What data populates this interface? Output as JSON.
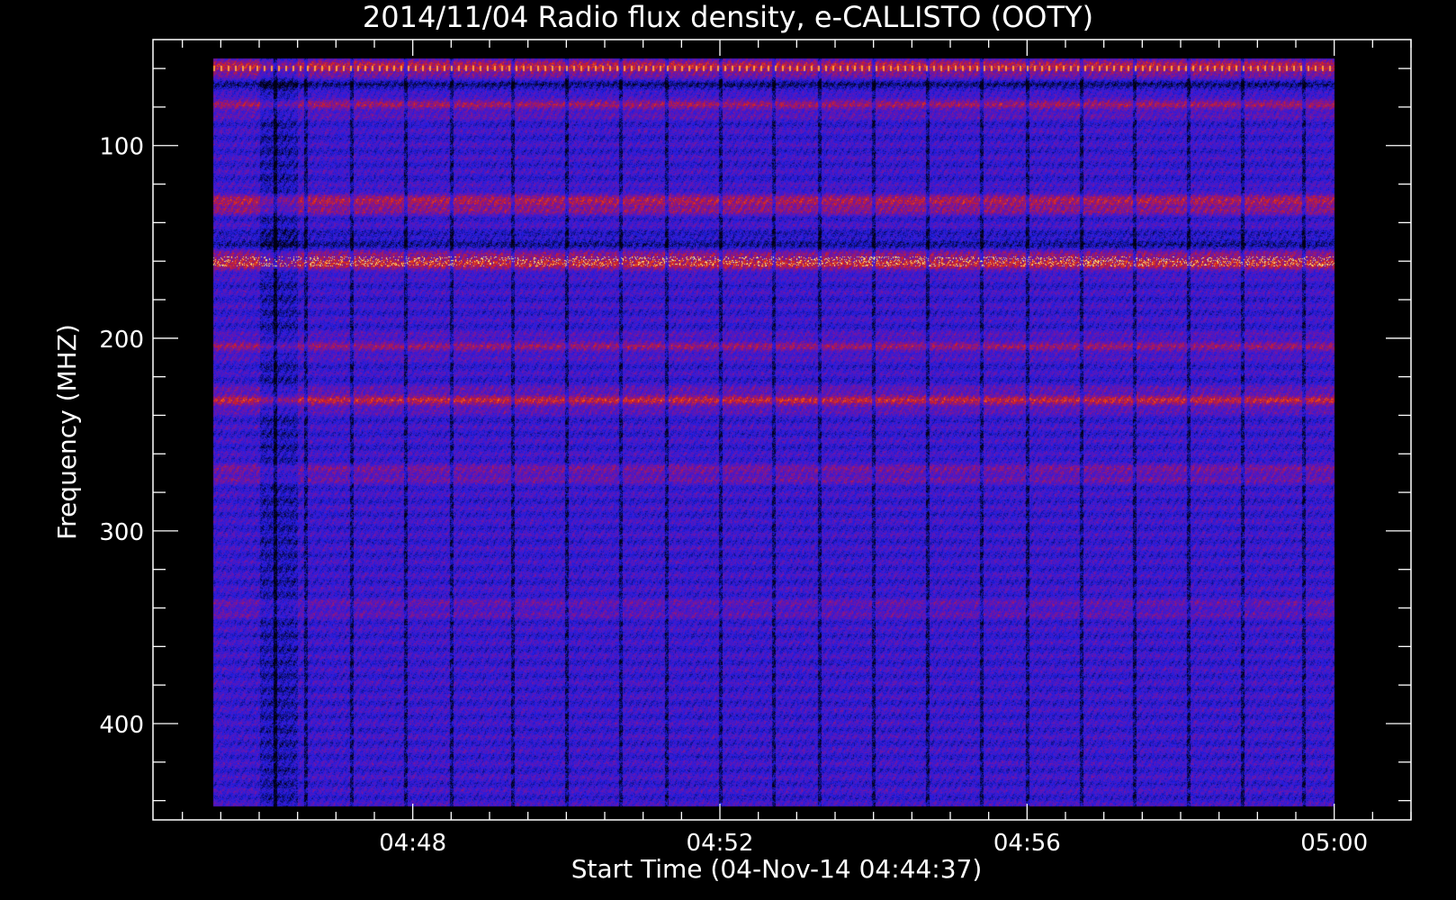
{
  "chart_data": {
    "type": "heatmap",
    "title": "2014/11/04  Radio flux density, e-CALLISTO (OOTY)",
    "xlabel": "Start Time (04-Nov-14 04:44:37)",
    "ylabel": "Frequency (MHZ)",
    "x_ticks": [
      "04:48",
      "04:52",
      "04:56",
      "05:00"
    ],
    "x_tick_minutes": [
      48,
      52,
      56,
      60
    ],
    "xlim_minutes": [
      44.617,
      61.0
    ],
    "data_x_minutes": [
      45.4,
      60.0
    ],
    "y_ticks": [
      "100",
      "200",
      "300",
      "400"
    ],
    "y_tick_values": [
      100,
      200,
      300,
      400
    ],
    "ylim": [
      45,
      450
    ],
    "ylim_data": [
      55,
      443
    ],
    "y_reversed": true,
    "colormap": [
      "#000000",
      "#1a1aff",
      "#7a1aa8",
      "#d01a1a",
      "#ff6a10",
      "#ffff80"
    ],
    "background": "#000000",
    "bright_bands_mhz": [
      {
        "freq": 60,
        "intensity": 0.95
      },
      {
        "freq": 79,
        "intensity": 0.6
      },
      {
        "freq": 130,
        "intensity": 0.9
      },
      {
        "freq": 160,
        "intensity": 1.0
      },
      {
        "freq": 204,
        "intensity": 0.55
      },
      {
        "freq": 232,
        "intensity": 0.85
      },
      {
        "freq": 270,
        "intensity": 0.5
      },
      {
        "freq": 340,
        "intensity": 0.35
      }
    ],
    "dark_bands_mhz": [
      {
        "freq": 68,
        "intensity": 0.9
      },
      {
        "freq": 150,
        "intensity": 0.8
      }
    ],
    "vertical_dark_stripes_minutes": [
      46.2,
      46.6,
      47.2,
      47.9,
      48.5,
      49.3,
      50.0,
      50.7,
      51.3,
      52.0,
      52.7,
      53.3,
      54.0,
      54.7,
      55.4,
      56.0,
      56.7,
      57.4,
      58.1,
      58.8,
      59.6
    ]
  }
}
